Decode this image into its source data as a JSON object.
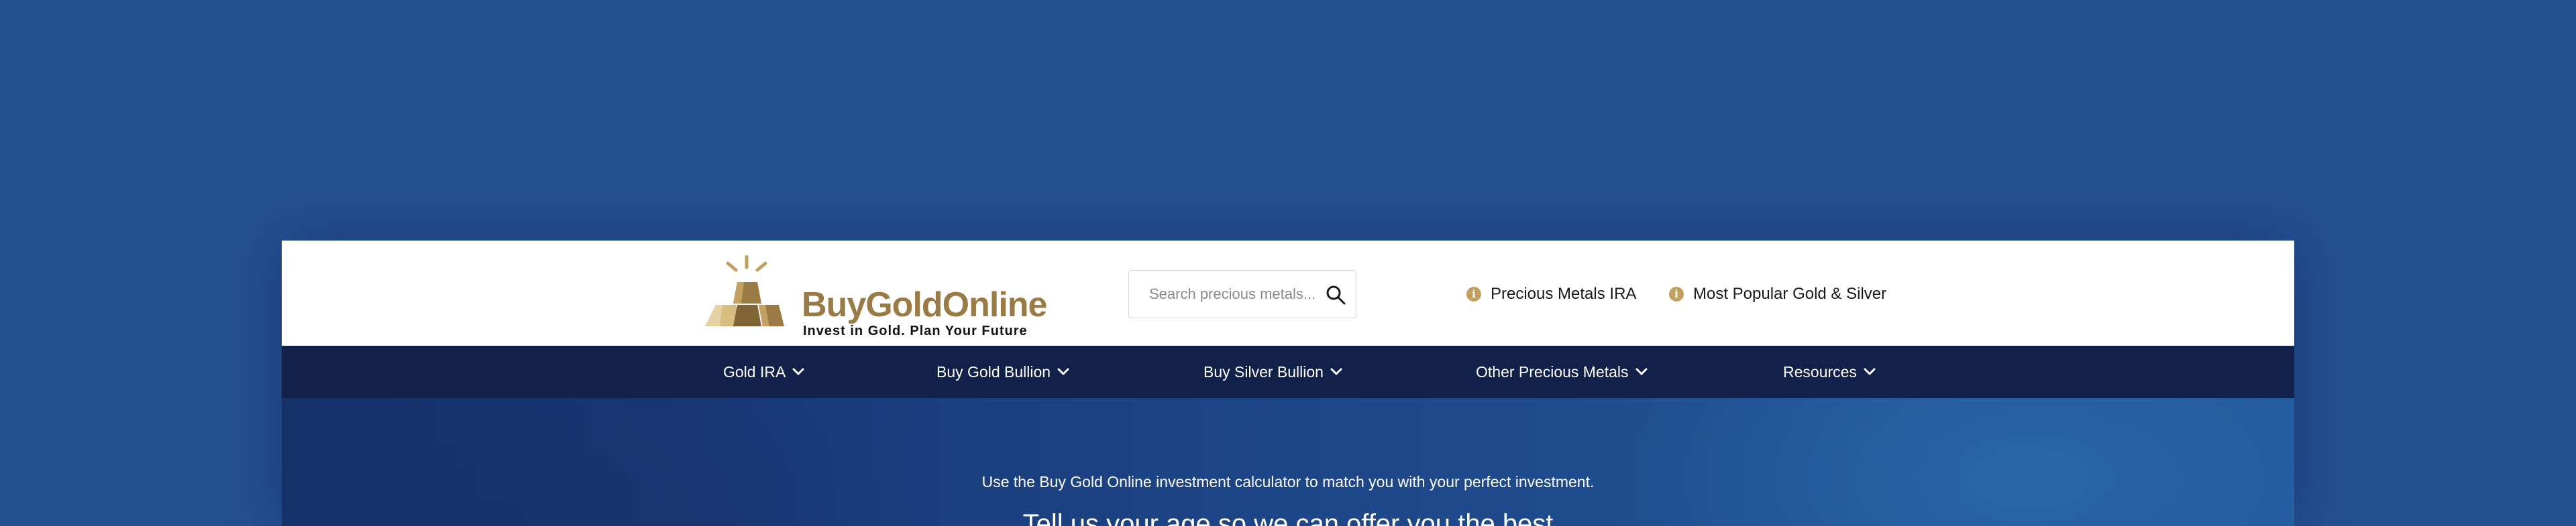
{
  "brand": {
    "name": "BuyGoldOnline",
    "tagline": "Invest in Gold. Plan Your Future",
    "gold_color": "#9a7b45",
    "accent_color": "#c2a060"
  },
  "search": {
    "placeholder": "Search precious metals...",
    "value": ""
  },
  "quick_links": [
    {
      "label": "Precious Metals IRA",
      "icon": "info-icon"
    },
    {
      "label": "Most Popular Gold & Silver",
      "icon": "info-icon"
    }
  ],
  "nav": {
    "items": [
      {
        "label": "Gold IRA"
      },
      {
        "label": "Buy Gold Bullion"
      },
      {
        "label": "Buy Silver Bullion"
      },
      {
        "label": "Other Precious Metals"
      },
      {
        "label": "Resources"
      }
    ],
    "background": "#11214a"
  },
  "hero": {
    "intro": "Use the Buy Gold Online investment calculator to match you with your perfect investment.",
    "heading": "Tell us your age so we can offer you the best"
  },
  "colors": {
    "page_background": "#234f93",
    "nav_background": "#11214a"
  }
}
